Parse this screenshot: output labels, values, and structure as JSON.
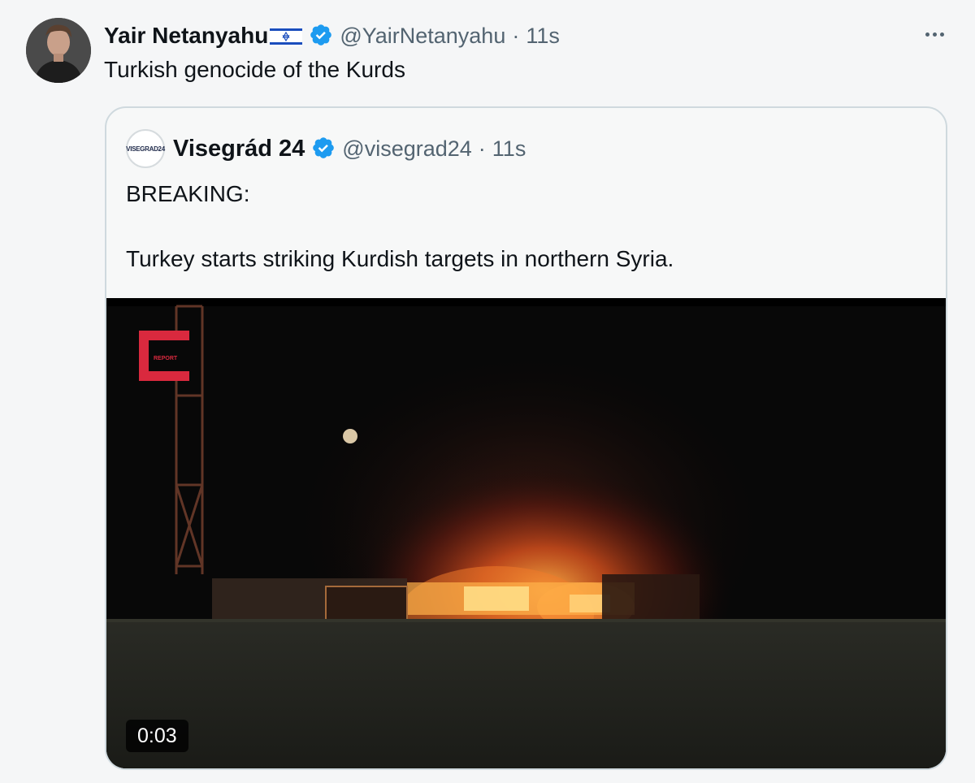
{
  "tweet": {
    "author_name": "Yair Netanyahu",
    "author_handle": "@YairNetanyahu",
    "separator": "·",
    "time": "11s",
    "text": "Turkish genocide of the Kurds"
  },
  "quote": {
    "author_name": "Visegrád 24",
    "author_handle": "@visegrad24",
    "separator": "·",
    "time": "11s",
    "avatar_text": "VISEGRAD24",
    "text": "BREAKING:\n\nTurkey starts striking Kurdish targets in northern Syria.",
    "video": {
      "duration": "0:03",
      "watermark": "REPORT"
    }
  },
  "icons": {
    "verified": "verified-badge-icon",
    "more": "more-options-icon",
    "flag": "israel-flag-icon"
  },
  "colors": {
    "background": "#f5f6f7",
    "text": "#0f1419",
    "muted": "#536471",
    "verified": "#1d9bf0",
    "border": "#cfd9de"
  }
}
